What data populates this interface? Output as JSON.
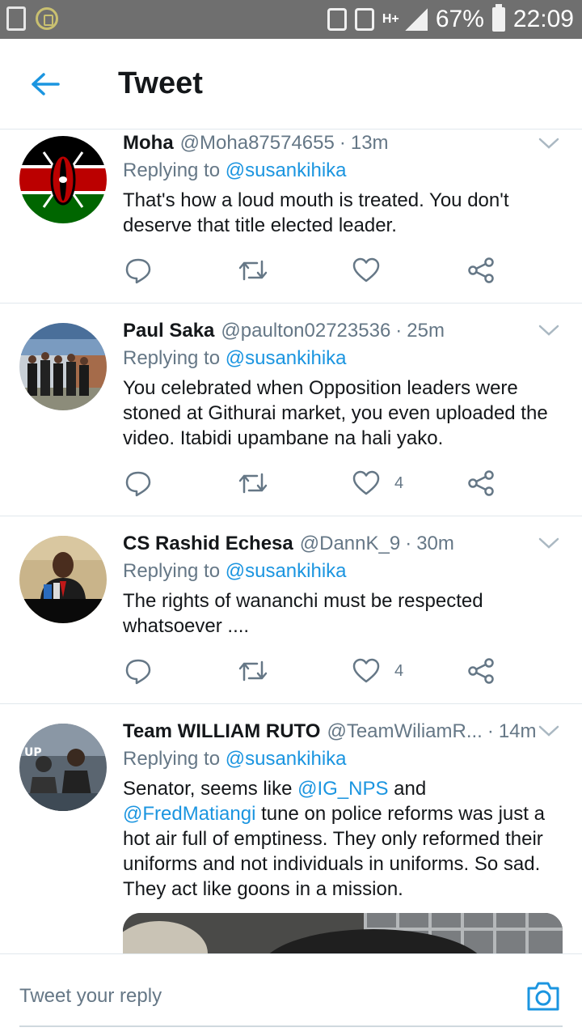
{
  "status_bar": {
    "battery": "67%",
    "time": "22:09",
    "network": "H+"
  },
  "header": {
    "title": "Tweet",
    "back_icon": "arrow-left-icon"
  },
  "tweets": [
    {
      "name": "Moha",
      "handle": "@Moha87574655",
      "time": "13m",
      "replying_label": "Replying to",
      "replying_to": "@susankihika",
      "text": "That's how a loud mouth is treated. You don't deserve that title elected leader.",
      "likes": ""
    },
    {
      "name": "Paul Saka",
      "handle": "@paulton02723536",
      "time": "25m",
      "replying_label": "Replying to",
      "replying_to": "@susankihika",
      "text": "You celebrated when Opposition leaders were stoned at Githurai market, you even uploaded the video. Itabidi upambane na hali yako.",
      "likes": "4"
    },
    {
      "name": "CS Rashid Echesa",
      "handle": "@DannK_9",
      "time": "30m",
      "replying_label": "Replying to",
      "replying_to": "@susankihika",
      "text": "The rights of wananchi must be respected whatsoever  ....",
      "likes": "4"
    },
    {
      "name": "Team WILLIAM RUTO",
      "handle": "@TeamWiliamR...",
      "time": "14m",
      "replying_label": "Replying to",
      "replying_to": "@susankihika",
      "text_pre": "Senator,  seems like ",
      "mention1": "@IG_NPS",
      "text_mid": " and ",
      "mention2": "@FredMatiangi",
      "text_post": " tune on police reforms was just a hot air full of emptiness. They only reformed their uniforms and not individuals in uniforms. So sad.",
      "text_last": "They act like goons in a mission."
    }
  ],
  "reply_bar": {
    "placeholder": "Tweet your reply",
    "camera_icon": "camera-icon"
  },
  "colors": {
    "accent": "#1b95e0",
    "muted": "#657786",
    "text": "#14171a",
    "divider": "#e1e8ed"
  }
}
